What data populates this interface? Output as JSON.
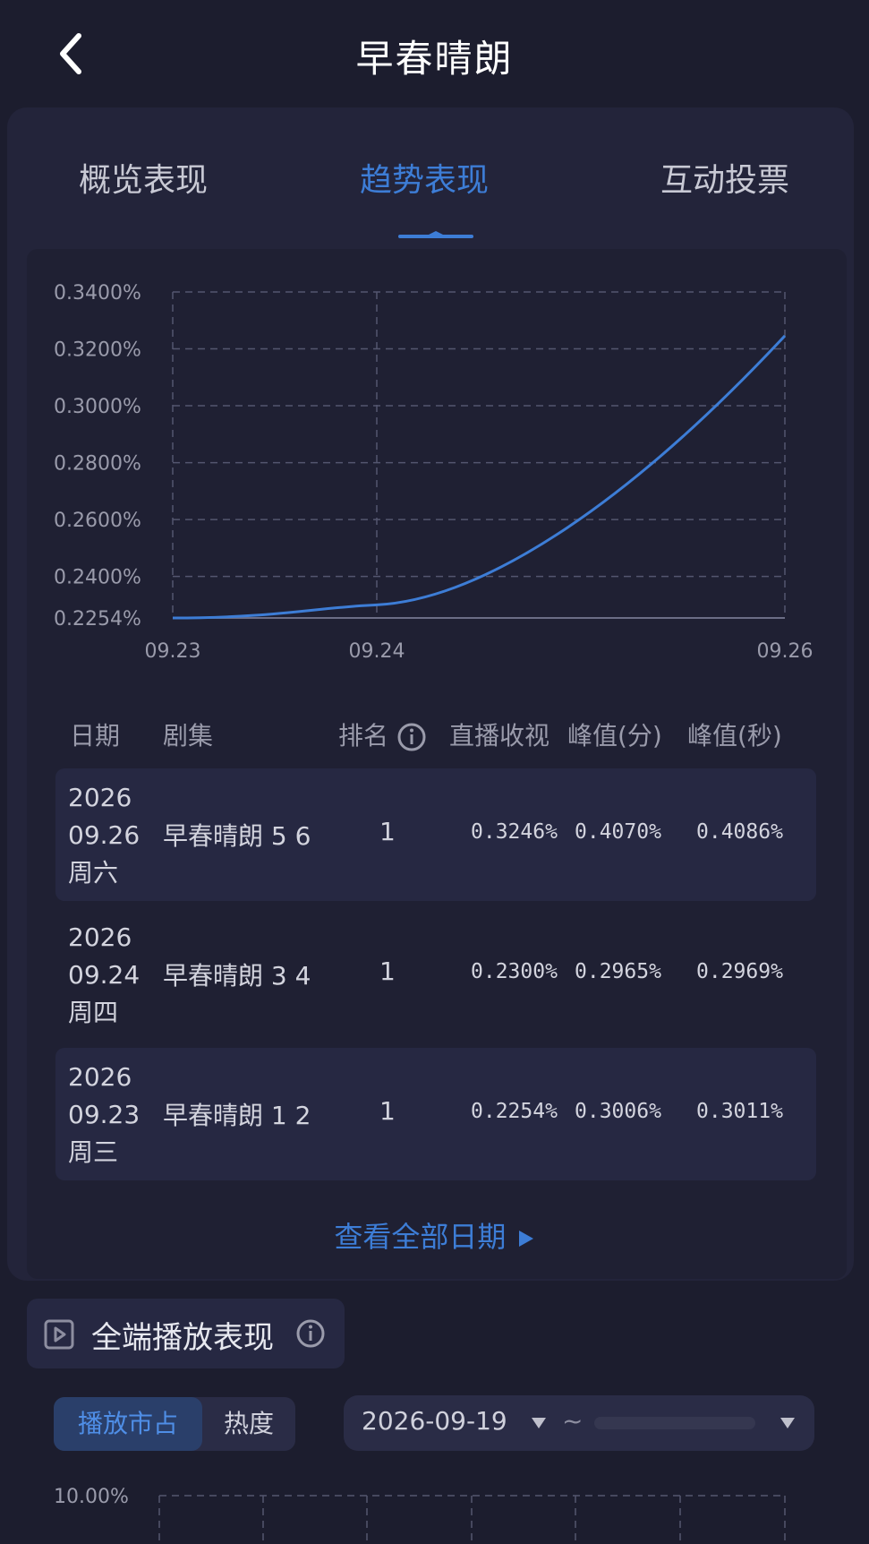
{
  "header": {
    "title": "早春晴朗",
    "back_icon": "chevron-left-icon"
  },
  "tabs": [
    {
      "label": "概览表现",
      "active": false
    },
    {
      "label": "趋势表现",
      "active": true
    },
    {
      "label": "互动投票",
      "active": false
    }
  ],
  "colors": {
    "accent": "#3d7dd6",
    "background": "#1c1d2e",
    "card": "#23243a",
    "line": "#3d7dd6"
  },
  "chart_data": {
    "type": "line",
    "x": [
      "09.23",
      "09.24",
      "09.26"
    ],
    "y_ticks": [
      "0.3400%",
      "0.3200%",
      "0.3000%",
      "0.2800%",
      "0.2600%",
      "0.2400%",
      "0.2254%"
    ],
    "series": [
      {
        "values": [
          0.2254,
          0.23,
          0.3246
        ]
      }
    ],
    "ylim": [
      0.2254,
      0.34
    ],
    "grid": true
  },
  "table": {
    "headers": {
      "date": "日期",
      "episode": "剧集",
      "rank": "排名",
      "live": "直播收视",
      "peak_min": "峰值(分)",
      "peak_sec": "峰值(秒)"
    },
    "rows": [
      {
        "year": "2026",
        "date": "09.26",
        "weekday": "周六",
        "episode": "早春晴朗 5 6",
        "rank": "1",
        "live": "0.3246%",
        "peak_min": "0.4070%",
        "peak_sec": "0.4086%"
      },
      {
        "year": "2026",
        "date": "09.24",
        "weekday": "周四",
        "episode": "早春晴朗 3 4",
        "rank": "1",
        "live": "0.2300%",
        "peak_min": "0.2965%",
        "peak_sec": "0.2969%"
      },
      {
        "year": "2026",
        "date": "09.23",
        "weekday": "周三",
        "episode": "早春晴朗 1 2",
        "rank": "1",
        "live": "0.2254%",
        "peak_min": "0.3006%",
        "peak_sec": "0.3011%"
      }
    ]
  },
  "view_all": {
    "label": "查看全部日期"
  },
  "section": {
    "title": "全端播放表现",
    "segments": [
      {
        "label": "播放市占",
        "active": true
      },
      {
        "label": "热度",
        "active": false
      }
    ],
    "date_range_start": "2026-09-19",
    "date_separator": "~",
    "bottom_chart_ytick": "10.00%"
  }
}
